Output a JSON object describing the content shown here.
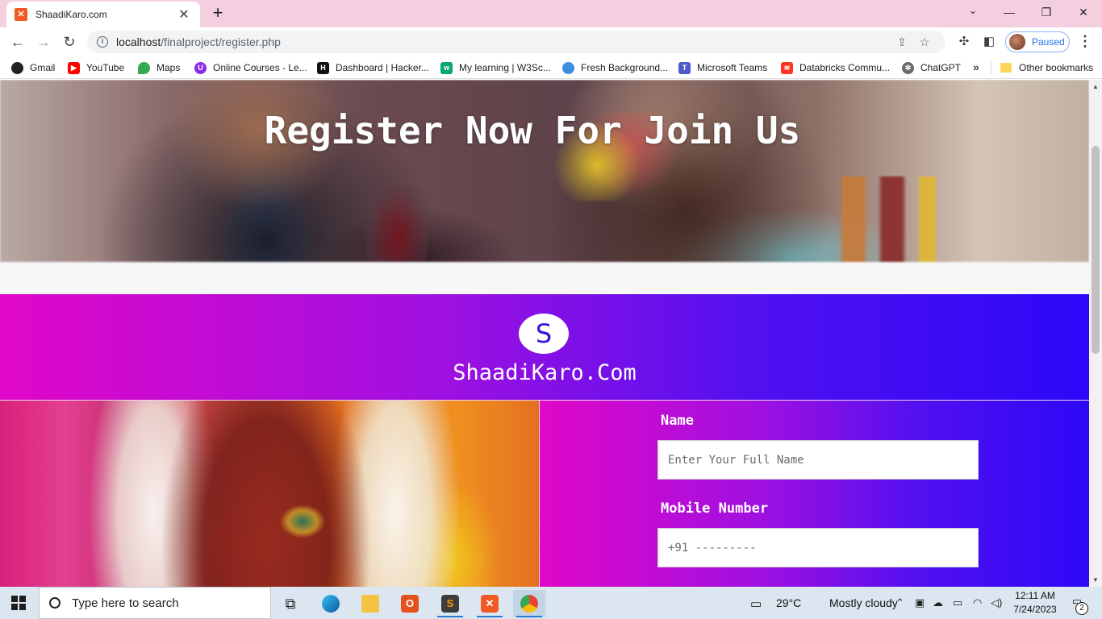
{
  "browser": {
    "tab": {
      "title": "ShaadiKaro.com",
      "close": "✕"
    },
    "new_tab": "+",
    "window_controls": {
      "tab_search": "⌄",
      "minimize": "—",
      "restore": "❐",
      "close": "✕"
    },
    "url": {
      "host": "localhost",
      "path": "/finalproject/register.php"
    },
    "profile": {
      "label": "Paused"
    },
    "bookmarks": [
      {
        "label": "Gmail",
        "color": "#202124"
      },
      {
        "label": "YouTube",
        "color": "#ff0000"
      },
      {
        "label": "Maps",
        "color": "#34a853"
      },
      {
        "label": "Online Courses - Le...",
        "color": "#8b2ce8"
      },
      {
        "label": "Dashboard | Hacker...",
        "color": "#111111"
      },
      {
        "label": "My learning | W3Sc...",
        "color": "#04aa6d"
      },
      {
        "label": "Fresh Background...",
        "color": "#3b8de0"
      },
      {
        "label": "Microsoft Teams",
        "color": "#5059c9"
      },
      {
        "label": "Databricks Commu...",
        "color": "#ff3621"
      },
      {
        "label": "ChatGPT",
        "color": "#6b6b6b"
      }
    ],
    "bookmarks_more": "»",
    "other_bookmarks": "Other bookmarks"
  },
  "page": {
    "hero_title": "Register Now For Join Us",
    "brand": {
      "logo_letter": "S",
      "name": "ShaadiKaro.Com"
    },
    "form": {
      "name_label": "Name",
      "name_placeholder": "Enter Your Full Name",
      "mobile_label": "Mobile Number",
      "mobile_placeholder": "+91 ---------"
    }
  },
  "taskbar": {
    "search_placeholder": "Type here to search",
    "weather": {
      "temp": "29°C",
      "condition": "Mostly cloudy"
    },
    "time": "12:11 AM",
    "date": "7/24/2023",
    "notification_count": "2"
  }
}
